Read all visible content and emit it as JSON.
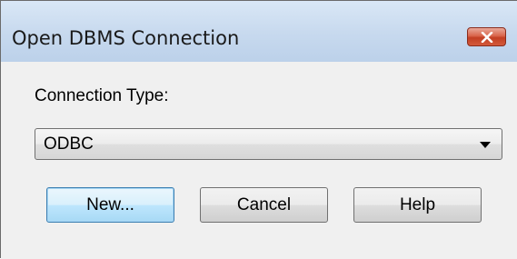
{
  "window": {
    "title": "Open DBMS Connection",
    "close_icon": "close-icon"
  },
  "form": {
    "connection_type_label": "Connection Type:",
    "connection_type_value": "ODBC"
  },
  "buttons": {
    "new_label": "New...",
    "cancel_label": "Cancel",
    "help_label": "Help"
  },
  "colors": {
    "titlebar": "#c7d9ee",
    "close_button": "#c23f23",
    "default_button_border": "#3c7fb1",
    "dialog_background": "#f0f0f0"
  }
}
